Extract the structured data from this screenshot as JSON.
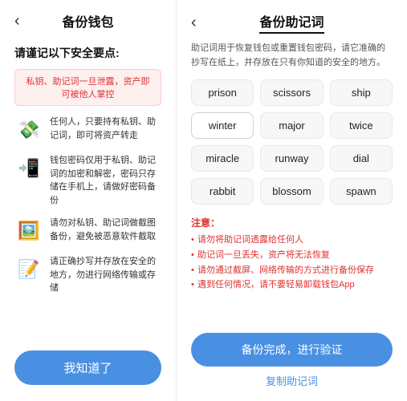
{
  "left": {
    "back_icon": "‹",
    "title": "备份钱包",
    "subtitle": "请谨记以下安全要点:",
    "warning": "私钥、助记词一旦泄露，资产即可被他人掌控",
    "security_items": [
      {
        "icon": "📱",
        "text": "任何人，只要持有私钥、助记词，即可将资产转走"
      },
      {
        "icon": "📲",
        "text": "钱包密码仅用于私钥、助记词的加密和解密，密码只存储在手机上，请做好密码备份"
      },
      {
        "icon": "🖼️",
        "text": "请勿对私钥、助记词做截图备份，避免被恶意软件截取"
      },
      {
        "icon": "📝",
        "text": "请正确抄写并存放在安全的地方，勿进行网络传输或存储"
      }
    ],
    "bottom_btn": "我知道了"
  },
  "right": {
    "back_icon": "‹",
    "title": "备份助记词",
    "desc": "助记词用于恢复钱包或重置钱包密码，请它准确的抄写在纸上，并存放在只有你知道的安全的地方。",
    "words": [
      "prison",
      "scissors",
      "ship",
      "winter",
      "major",
      "twice",
      "miracle",
      "runway",
      "dial",
      "rabbit",
      "blossom",
      "spawn"
    ],
    "notes_title": "注意：",
    "notes": [
      "请勿将助记词透露给任何人",
      "助记词一旦丢失，资产将无法恢复",
      "请勿通过截屏、网络传输的方式进行备份保存",
      "遇到任何情况，请不要轻易卸载钱包App"
    ],
    "verify_btn": "备份完成，进行验证",
    "copy_btn": "复制助记词"
  },
  "colors": {
    "primary": "#4a90e2",
    "danger": "#e03030",
    "warning_bg": "#fff0f0"
  }
}
